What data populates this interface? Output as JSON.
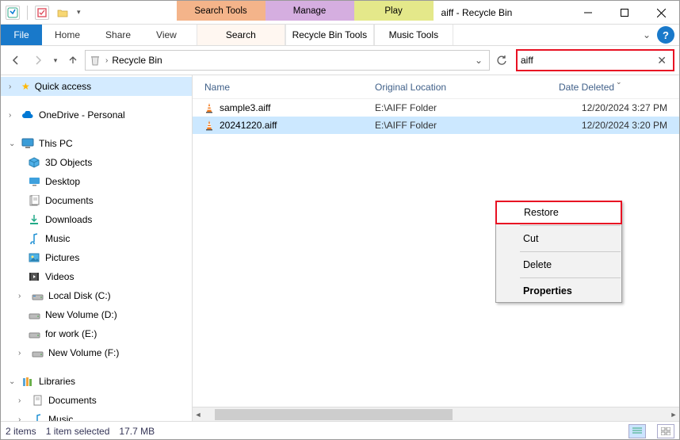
{
  "window": {
    "title": "aiff - Recycle Bin"
  },
  "toolTabs": {
    "search": "Search Tools",
    "manage": "Manage",
    "play": "Play"
  },
  "ribbon": {
    "file": "File",
    "home": "Home",
    "share": "Share",
    "view": "View",
    "search": "Search",
    "recyclebin": "Recycle Bin Tools",
    "music": "Music Tools"
  },
  "breadcrumb": {
    "location": "Recycle Bin"
  },
  "search": {
    "value": "aiff"
  },
  "columns": {
    "name": "Name",
    "origLoc": "Original Location",
    "dateDel": "Date Deleted"
  },
  "files": [
    {
      "name": "sample3.aiff",
      "location": "E:\\AIFF Folder",
      "date": "12/20/2024 3:27 PM"
    },
    {
      "name": "20241220.aiff",
      "location": "E:\\AIFF Folder",
      "date": "12/20/2024 3:20 PM"
    }
  ],
  "sidebar": {
    "quickAccess": "Quick access",
    "onedrive": "OneDrive - Personal",
    "thisPC": "This PC",
    "objects3d": "3D Objects",
    "desktop": "Desktop",
    "documents": "Documents",
    "downloads": "Downloads",
    "music": "Music",
    "pictures": "Pictures",
    "videos": "Videos",
    "localC": "Local Disk (C:)",
    "volD": "New Volume (D:)",
    "volE": "for work (E:)",
    "volF": "New Volume (F:)",
    "libraries": "Libraries",
    "libDocs": "Documents",
    "libMusic": "Music"
  },
  "contextMenu": {
    "restore": "Restore",
    "cut": "Cut",
    "delete": "Delete",
    "properties": "Properties"
  },
  "status": {
    "itemCount": "2 items",
    "selection": "1 item selected",
    "size": "17.7 MB"
  }
}
